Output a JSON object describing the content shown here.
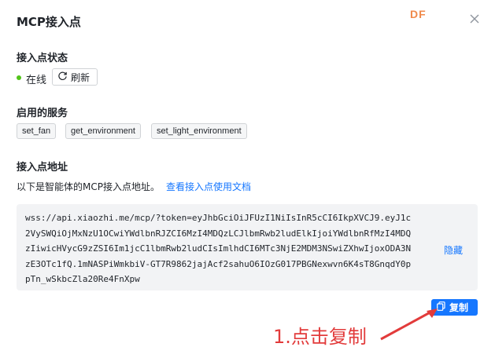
{
  "dialog": {
    "title": "MCP接入点",
    "logo_text": "DF"
  },
  "status_section": {
    "label": "接入点状态",
    "status_text": "在线",
    "status_color": "#52c41a",
    "refresh_label": "刷新"
  },
  "services_section": {
    "label": "启用的服务",
    "services": [
      "set_fan",
      "get_environment",
      "set_light_environment"
    ]
  },
  "address_section": {
    "label": "接入点地址",
    "description": "以下是智能体的MCP接入点地址。",
    "doc_link": "查看接入点使用文档",
    "url_lines": [
      "wss://api.xiaozhi.me/mcp/?token=eyJhbGciOiJFUzI1NiIsInR5cCI6IkpXVCJ9.eyJ1c",
      "2VySWQiOjMxNzU1OCwiYWdlbnRJZCI6MzI4MDQzLCJlbmRwb2ludElkIjoiYWdlbnRfMzI4MDQ",
      "zIiwicHVycG9zZSI6Im1jcC1lbmRwb2ludCIsImlhdCI6MTc3NjE2MDM3NSwiZXhwIjoxODA3N",
      "zE3OTc1fQ.1mNASPiWmkbiV-GT7R9862jajAcf2sahuO6IOzG017PBGNexwvn6K4sT8GnqdY0p",
      "pTn_wSkbcZla20Re4FnXpw"
    ],
    "hide_label": "隐藏",
    "copy_label": "复制"
  },
  "annotation": {
    "text": "1.点击复制",
    "color": "#e23b3b"
  },
  "colors": {
    "accent": "#1677ff",
    "url_bg": "#f2f3f5"
  }
}
